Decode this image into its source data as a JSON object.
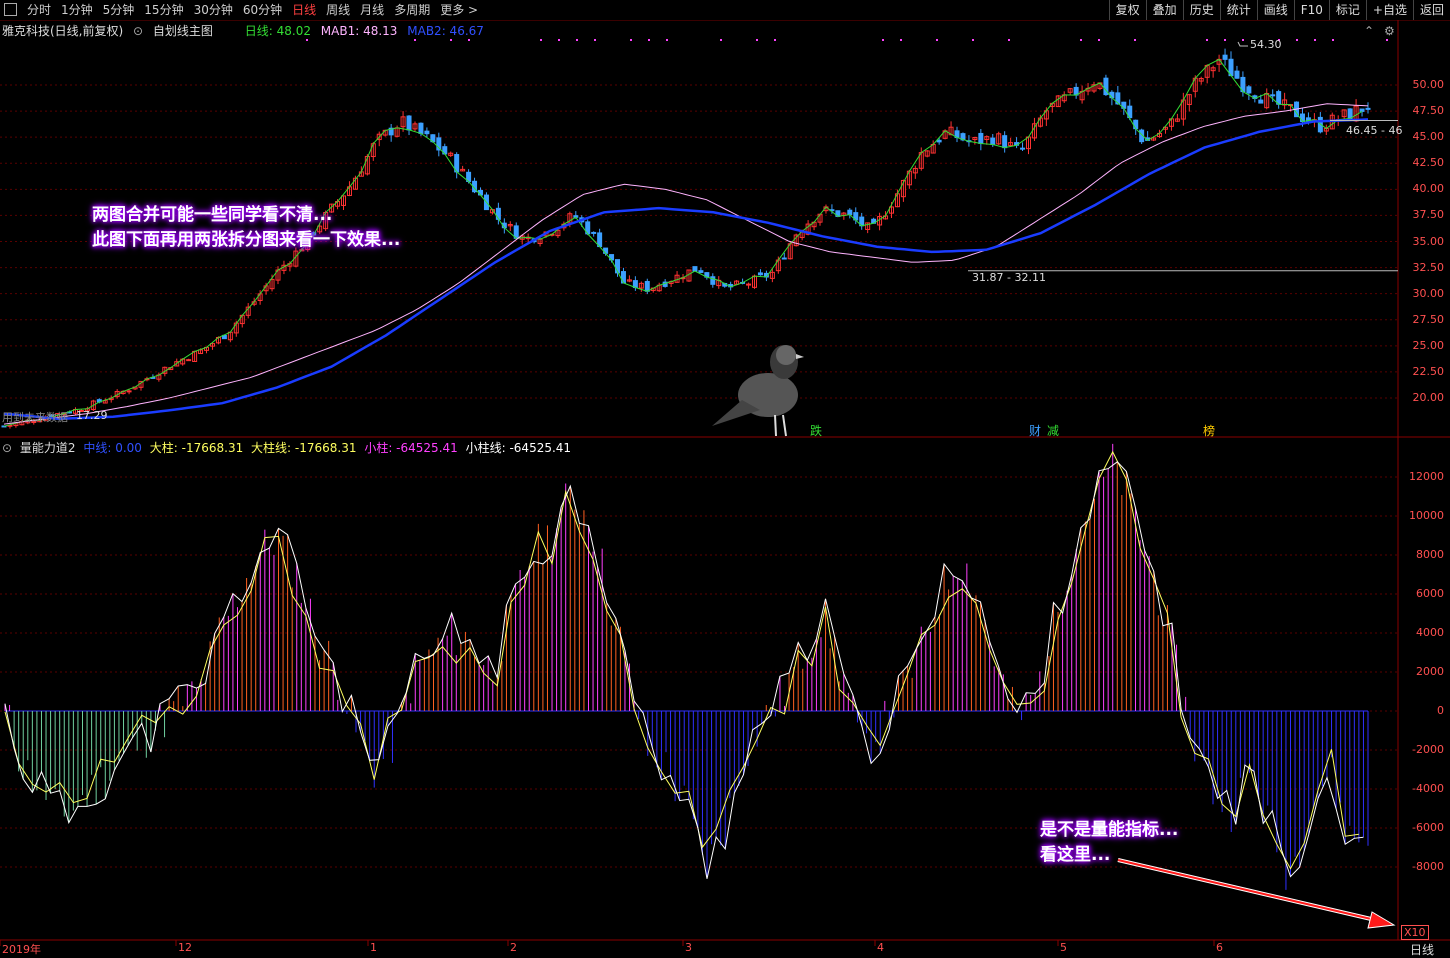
{
  "toolbar": {
    "tabs": [
      "分时",
      "1分钟",
      "5分钟",
      "15分钟",
      "30分钟",
      "60分钟",
      "日线",
      "周线",
      "月线",
      "多周期",
      "更多 >"
    ],
    "active_tab": "日线",
    "right_buttons": [
      "复权",
      "叠加",
      "历史",
      "统计",
      "画线",
      "F10",
      "标记",
      "+自选",
      "返回"
    ]
  },
  "upper_header": {
    "stock": "雅克科技(日线,前复权)",
    "template": "自划线主图",
    "day_label": "日线: 48.02",
    "mab1": "MAB1: 48.13",
    "mab2": "MAB2: 46.67"
  },
  "lower_header": {
    "indicator": "量能力道2",
    "mid": "中线: 0.00",
    "big": "大柱: -17668.31",
    "bigline": "大柱线: -17668.31",
    "small": "小柱: -64525.41",
    "smallline": "小柱线: -64525.41"
  },
  "annotations": {
    "top": "两图合并可能一些同学看不清...\n此图下面再用两张拆分图来看一下效果...",
    "bottom": "是不是量能指标...\n看这里..."
  },
  "labels": {
    "peak": "54.30",
    "trough": "31.87 - 32.11",
    "right_range": "46.45 - 46",
    "left_note": "用到未来数据",
    "left_val": "17.29",
    "event1": "跌",
    "event2": "财",
    "event3": "减",
    "event4": "榜",
    "x10": "X10",
    "period": "日线"
  },
  "colors": {
    "up": "#ff3232",
    "down": "#3ca0ff",
    "ma1": "#ffb4ff",
    "ma2": "#1a3cff",
    "day": "#33dd33",
    "pos_bar": "#ff40ff",
    "neg_bar": "#3030ff",
    "grid": "#5a0000"
  },
  "chart_data": [
    {
      "type": "candlestick",
      "title": "雅克科技(日线,前复权)",
      "ylim": [
        17.5,
        54.3
      ],
      "yticks": [
        20.0,
        22.5,
        25.0,
        27.5,
        30.0,
        32.5,
        35.0,
        37.5,
        40.0,
        42.5,
        45.0,
        47.5,
        50.0
      ],
      "x_ticks": [
        "2019年",
        "12",
        "1",
        "2",
        "3",
        "4",
        "5",
        "6"
      ],
      "close_path": [
        17.3,
        17.8,
        18.4,
        18.9,
        19.8,
        20.8,
        22.2,
        23.5,
        24.6,
        26.2,
        29.0,
        32.0,
        34.5,
        37.5,
        40.5,
        44.5,
        46.5,
        45.0,
        43.0,
        40.0,
        37.0,
        35.2,
        36.0,
        37.5,
        35.0,
        31.0,
        30.5,
        31.5,
        32.5,
        30.5,
        31.0,
        32.0,
        36.0,
        38.0,
        37.5,
        36.0,
        39.5,
        43.5,
        45.5,
        44.5,
        45.0,
        43.5,
        47.5,
        49.0,
        50.5,
        48.0,
        44.5,
        46.0,
        50.0,
        52.5,
        50.0,
        48.5,
        47.5,
        46.0,
        47.0,
        48.0
      ],
      "ma1_path": [
        17.5,
        18.0,
        18.5,
        19.2,
        20.0,
        21.0,
        22.0,
        23.5,
        25.0,
        26.5,
        28.5,
        31.0,
        34.0,
        37.0,
        39.5,
        40.5,
        40.0,
        39.0,
        37.0,
        35.0,
        34.0,
        33.5,
        33.0,
        33.2,
        34.5,
        37.0,
        39.5,
        42.5,
        44.5,
        46.0,
        47.0,
        47.5,
        48.2,
        48.0
      ],
      "ma2_path": [
        18.5,
        18.0,
        18.2,
        18.8,
        19.5,
        21.0,
        23.0,
        26.0,
        29.5,
        33.0,
        36.0,
        37.8,
        38.2,
        37.8,
        36.8,
        35.5,
        34.5,
        34.0,
        34.2,
        35.8,
        38.5,
        41.5,
        44.0,
        45.5,
        46.5,
        46.7
      ],
      "peak": 54.3,
      "trough": [
        31.87,
        32.11
      ]
    },
    {
      "type": "bar",
      "title": "量能力道2",
      "ylim": [
        -10000,
        13000
      ],
      "yticks": [
        -8000,
        -6000,
        -4000,
        -2000,
        0,
        2000,
        4000,
        6000,
        8000,
        10000,
        12000
      ],
      "mid": 0,
      "values": [
        0,
        -3000,
        -4000,
        -5500,
        -4500,
        -3500,
        -2500,
        -1500,
        -500,
        500,
        1000,
        4000,
        6000,
        8000,
        9000,
        7000,
        4000,
        2000,
        -1000,
        -3000,
        -1500,
        2000,
        3000,
        4000,
        3500,
        2000,
        5000,
        8000,
        9000,
        11000,
        10000,
        6000,
        2000,
        -2000,
        -3000,
        -5000,
        -8000,
        -6000,
        -2000,
        -500,
        1000,
        3000,
        5000,
        2000,
        -2000,
        -1000,
        1000,
        3000,
        6000,
        8000,
        6000,
        2000,
        -500,
        1000,
        5000,
        9000,
        11000,
        12800,
        10000,
        7000,
        3000,
        -1500,
        -4000,
        -5000,
        -3000,
        -6000,
        -8500,
        -5000,
        -3000,
        -6500,
        -6400
      ],
      "small_line": -64525.41,
      "big_line": -17668.31
    }
  ]
}
